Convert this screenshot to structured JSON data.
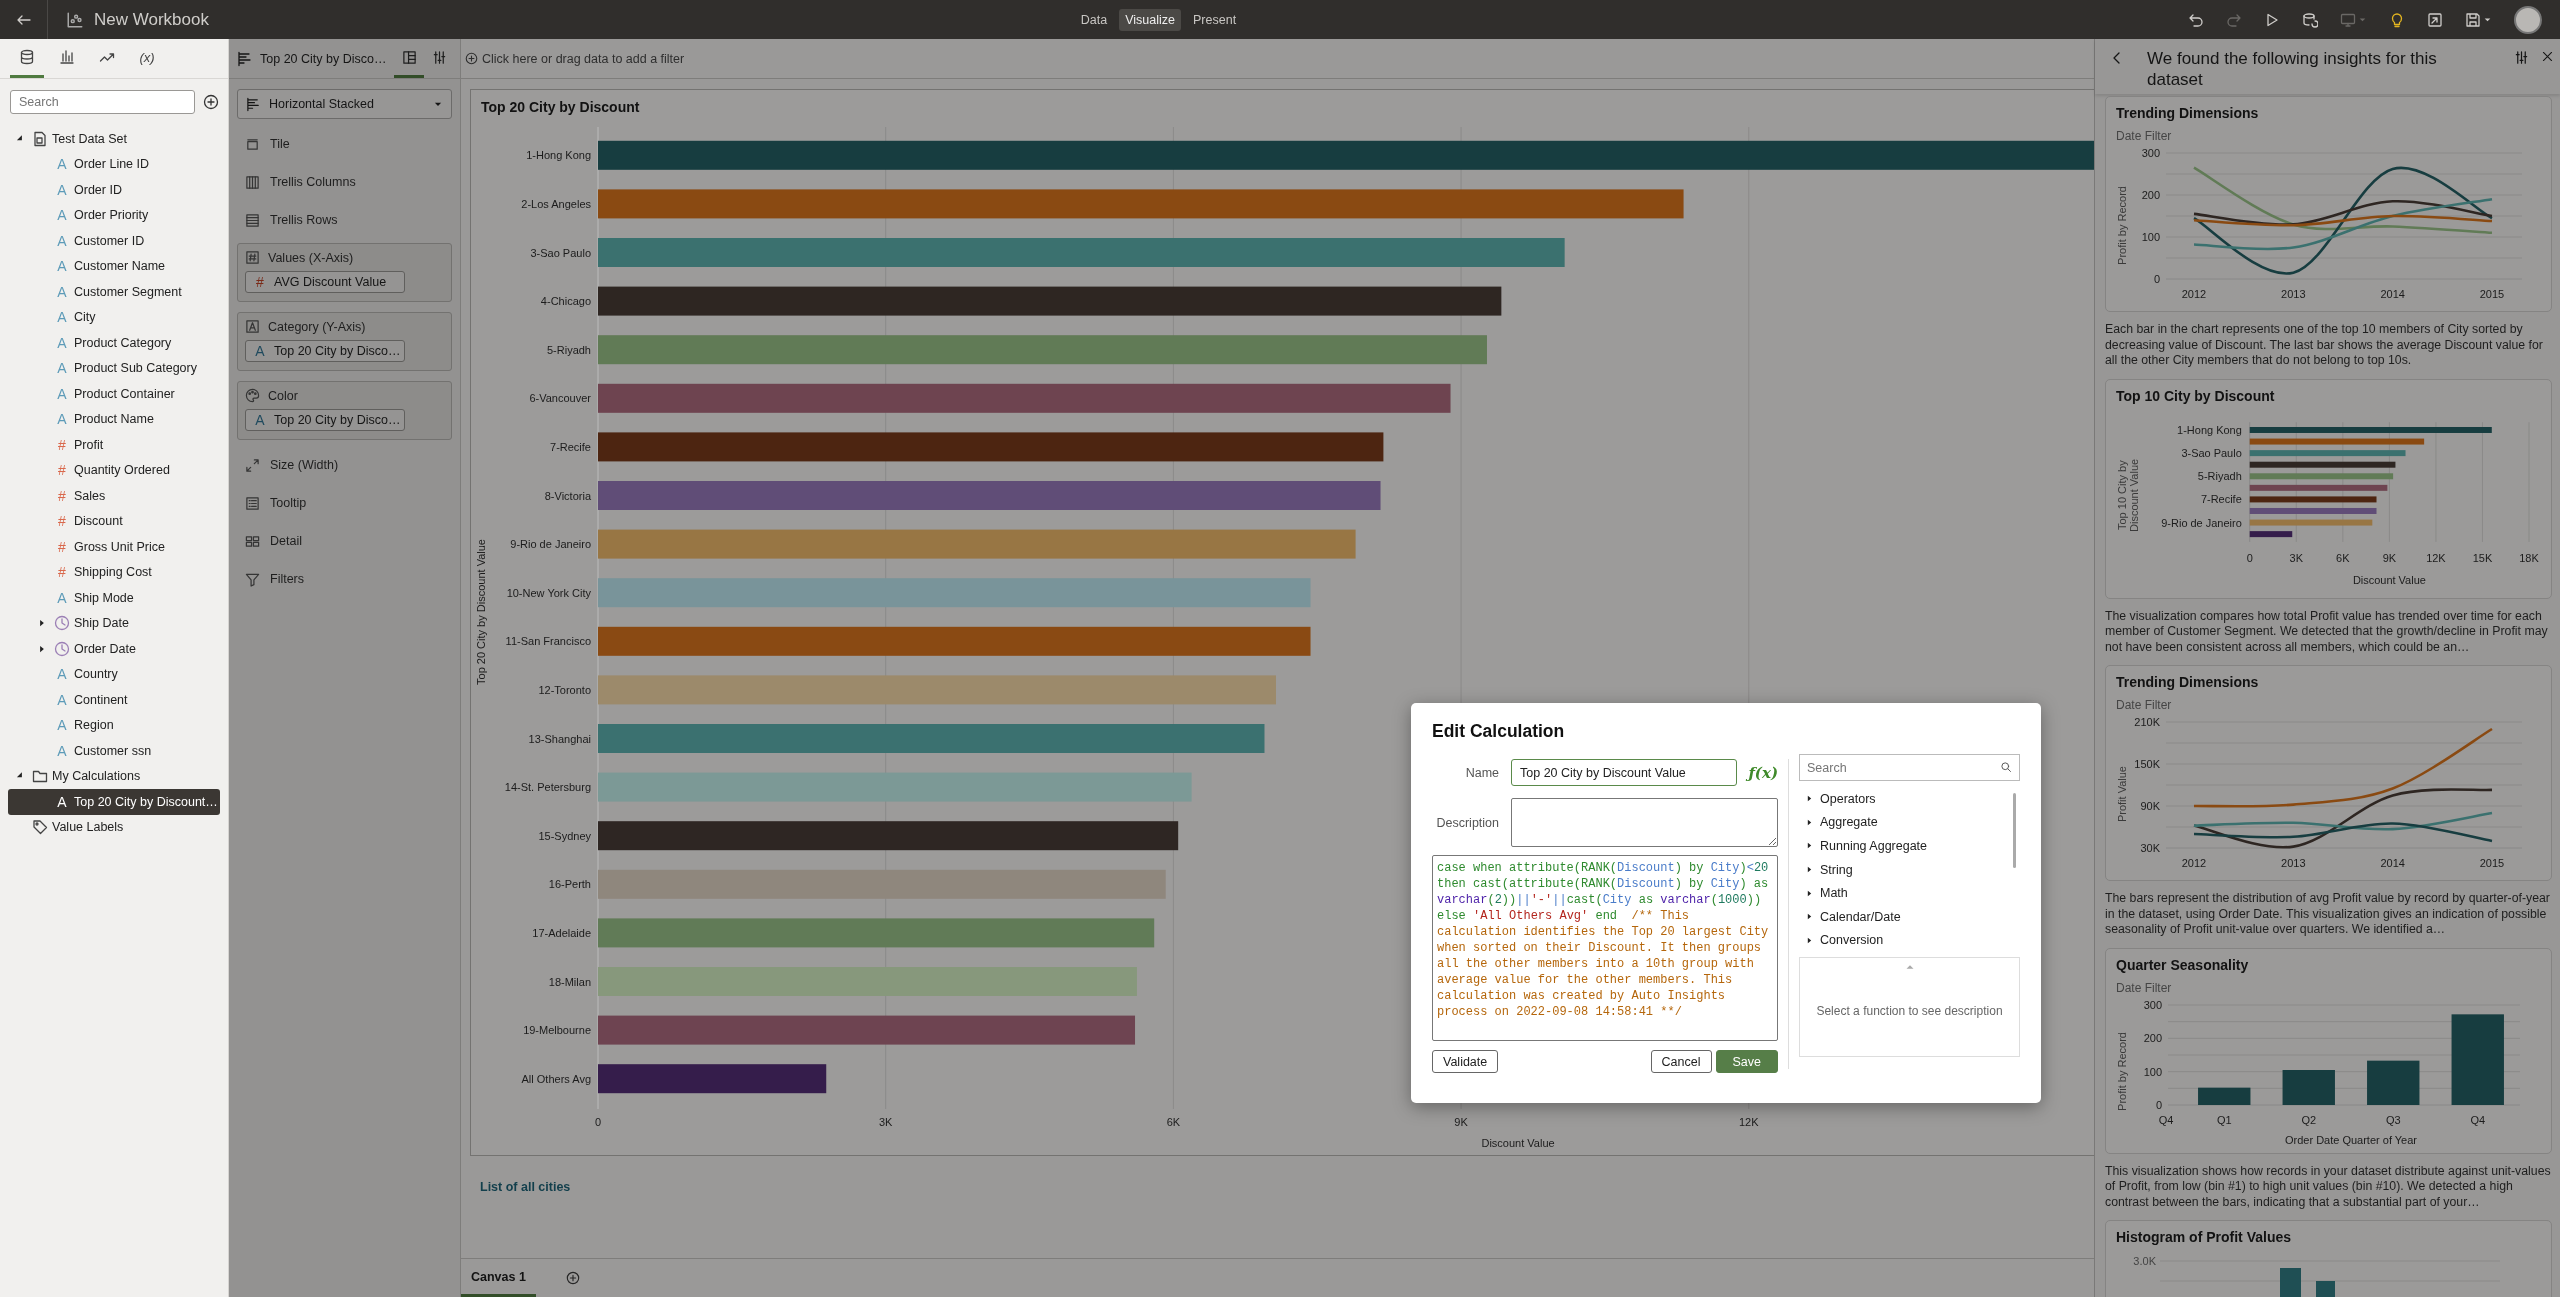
{
  "top_bar": {
    "title": "New Workbook",
    "modes": [
      {
        "label": "Data",
        "selected": false
      },
      {
        "label": "Visualize",
        "selected": true
      },
      {
        "label": "Present",
        "selected": false
      }
    ],
    "actions": [
      {
        "kind": "undo",
        "disabled": false
      },
      {
        "kind": "redo",
        "disabled": true
      },
      {
        "kind": "play",
        "disabled": false
      },
      {
        "kind": "refresh",
        "disabled": false
      },
      {
        "kind": "layout",
        "disabled": true
      },
      {
        "kind": "insights",
        "disabled": false
      },
      {
        "kind": "export",
        "disabled": false
      },
      {
        "kind": "save",
        "disabled": false
      }
    ]
  },
  "data_panel": {
    "tabs": [
      {
        "kind": "data",
        "selected": true
      },
      {
        "kind": "visualizations",
        "selected": false
      },
      {
        "kind": "analytics",
        "selected": false
      },
      {
        "kind": "calculations",
        "label": "(x)",
        "selected": false
      }
    ],
    "search": {
      "placeholder": "Search"
    },
    "tree": [
      {
        "label": "Test Data Set",
        "kind": "dataset",
        "expanded": true,
        "selected": false,
        "children": [
          {
            "label": "Order Line ID",
            "kind": "attribute",
            "icon": "A",
            "selected": false
          },
          {
            "label": "Order ID",
            "kind": "attribute",
            "icon": "A",
            "selected": false
          },
          {
            "label": "Order Priority",
            "kind": "attribute",
            "icon": "A",
            "selected": false
          },
          {
            "label": "Customer ID",
            "kind": "attribute",
            "icon": "A",
            "selected": false
          },
          {
            "label": "Customer Name",
            "kind": "attribute",
            "icon": "A",
            "selected": false
          },
          {
            "label": "Customer Segment",
            "kind": "attribute",
            "icon": "A",
            "selected": false
          },
          {
            "label": "City",
            "kind": "attribute",
            "icon": "A",
            "selected": false
          },
          {
            "label": "Product Category",
            "kind": "attribute",
            "icon": "A",
            "selected": false
          },
          {
            "label": "Product Sub Category",
            "kind": "attribute",
            "icon": "A",
            "selected": false
          },
          {
            "label": "Product Container",
            "kind": "attribute",
            "icon": "A",
            "selected": false
          },
          {
            "label": "Product Name",
            "kind": "attribute",
            "icon": "A",
            "selected": false
          },
          {
            "label": "Profit",
            "kind": "measure",
            "icon": "#",
            "selected": false
          },
          {
            "label": "Quantity Ordered",
            "kind": "measure",
            "icon": "#",
            "selected": false
          },
          {
            "label": "Sales",
            "kind": "measure",
            "icon": "#",
            "selected": false
          },
          {
            "label": "Discount",
            "kind": "measure",
            "icon": "#",
            "selected": false
          },
          {
            "label": "Gross Unit Price",
            "kind": "measure",
            "icon": "#",
            "selected": false
          },
          {
            "label": "Shipping Cost",
            "kind": "measure",
            "icon": "#",
            "selected": false
          },
          {
            "label": "Ship Mode",
            "kind": "attribute",
            "icon": "A",
            "selected": false
          },
          {
            "label": "Ship Date",
            "kind": "date",
            "expanded": false,
            "selected": false
          },
          {
            "label": "Order Date",
            "kind": "date",
            "expanded": false,
            "selected": false
          },
          {
            "label": "Country",
            "kind": "attribute",
            "icon": "A",
            "selected": false
          },
          {
            "label": "Continent",
            "kind": "attribute",
            "icon": "A",
            "selected": false
          },
          {
            "label": "Region",
            "kind": "attribute",
            "icon": "A",
            "selected": false
          },
          {
            "label": "Customer ssn",
            "kind": "attribute",
            "icon": "A",
            "selected": false
          }
        ]
      },
      {
        "label": "My Calculations",
        "kind": "folder",
        "expanded": true,
        "selected": false,
        "children": [
          {
            "label": "Top 20 City by Discount…",
            "kind": "attribute",
            "icon": "A",
            "selected": true
          }
        ]
      },
      {
        "label": "Value Labels",
        "kind": "labels",
        "selected": false
      }
    ]
  },
  "grammar_panel": {
    "tab": "Top 20 City by Disco…",
    "view_tabs": [
      {
        "kind": "layout",
        "selected": true
      },
      {
        "kind": "properties",
        "selected": false
      }
    ],
    "chart_type": "Horizontal Stacked",
    "items": [
      {
        "kind": "tile",
        "label": "Tile"
      },
      {
        "kind": "columns",
        "label": "Trellis Columns"
      },
      {
        "kind": "rows",
        "label": "Trellis Rows"
      },
      {
        "kind": "values_zone",
        "label": "Values (X-Axis)",
        "pill": {
          "kind": "measure",
          "icon": "#",
          "label": "AVG Discount Value"
        }
      },
      {
        "kind": "category_zone",
        "label": "Category (Y-Axis)",
        "pill": {
          "kind": "attribute",
          "icon": "A",
          "label": "Top 20 City by Disco…"
        }
      },
      {
        "kind": "color_zone",
        "label": "Color",
        "pill": {
          "kind": "attribute",
          "icon": "A",
          "label": "Top 20 City by Disco…"
        }
      },
      {
        "kind": "size",
        "label": "Size (Width)"
      },
      {
        "kind": "tooltip",
        "label": "Tooltip"
      },
      {
        "kind": "detail",
        "label": "Detail"
      },
      {
        "kind": "filters",
        "label": "Filters"
      }
    ]
  },
  "filter_bar": {
    "placeholder": "Click here or drag data to add a filter"
  },
  "main_chart": {
    "title": "Top 20 City by Discount",
    "bars": [
      {
        "color": "#173d40"
      },
      {
        "color": "#8a4a12"
      },
      {
        "color": "#3b716f"
      },
      {
        "color": "#2e2622"
      },
      {
        "color": "#617b56"
      },
      {
        "color": "#6e4450"
      },
      {
        "color": "#4d2511"
      },
      {
        "color": "#604d77"
      },
      {
        "color": "#987644"
      },
      {
        "color": "#79949a"
      },
      {
        "color": "#8a4a13"
      },
      {
        "color": "#9c8a6b"
      },
      {
        "color": "#3b7170"
      },
      {
        "color": "#7c9996"
      },
      {
        "color": "#2e2623"
      },
      {
        "color": "#8f877d"
      },
      {
        "color": "#617b57"
      },
      {
        "color": "#87987c"
      },
      {
        "color": "#6e4451"
      },
      {
        "color": "#351d4b"
      }
    ],
    "chart_data": {
      "type": "bar",
      "orientation": "horizontal",
      "xlabel": "Discount Value",
      "ylabel": "Top 20 City by Discount Value",
      "grid": true,
      "categories": [
        "1-Hong Kong",
        "2-Los Angeles",
        "3-Sao Paulo",
        "4-Chicago",
        "5-Riyadh",
        "6-Vancouver",
        "7-Recife",
        "8-Victoria",
        "9-Rio de Janeiro",
        "10-New York City",
        "11-San Francisco",
        "12-Toronto",
        "13-Shanghai",
        "14-St. Petersburg",
        "15-Sydney",
        "16-Perth",
        "17-Adelaide",
        "18-Milan",
        "19-Melbourne",
        "All Others Avg"
      ],
      "series": [
        {
          "values": [
            15600,
            11320,
            10080,
            9420,
            9270,
            8890,
            8190,
            8160,
            7900,
            7430,
            7430,
            7070,
            6950,
            6190,
            6050,
            5920,
            5800,
            5620,
            5600,
            2380
          ]
        }
      ],
      "xlim": [
        0,
        15600
      ],
      "xticks": [
        {
          "value": 0,
          "label": "0"
        },
        {
          "value": 3000,
          "label": "3K"
        },
        {
          "value": 6000,
          "label": "6K"
        },
        {
          "value": 9000,
          "label": "9K"
        },
        {
          "value": 12000,
          "label": "12K"
        }
      ]
    }
  },
  "link": "List of all cities",
  "canvas_tabs": [
    {
      "label": "Canvas 1",
      "selected": true
    }
  ],
  "insights": {
    "title": "We found the following insights for this dataset",
    "blocks": [
      {
        "kind": "chart_card",
        "title": "Trending Dimensions",
        "filter": "Date Filter",
        "chart_data": {
          "type": "line",
          "ylabel": "Profit by Record",
          "x": [
            "2012",
            "2013",
            "2014",
            "2015"
          ],
          "ylim": [
            0,
            300
          ],
          "yticks": [
            0,
            100,
            200,
            300
          ],
          "grid": true,
          "series": [
            {
              "color": "#617b56",
              "values": [
                265,
                130,
                125,
                110
              ]
            },
            {
              "color": "#173d40",
              "values": [
                145,
                15,
                262,
                145
              ]
            },
            {
              "color": "#2e2622",
              "values": [
                155,
                130,
                185,
                150
              ]
            },
            {
              "color": "#3b716f",
              "values": [
                82,
                75,
                150,
                190
              ]
            },
            {
              "color": "#8a4a12",
              "values": [
                140,
                128,
                150,
                138
              ]
            }
          ]
        }
      },
      {
        "kind": "text",
        "text": "Each bar in the chart represents one of the top 10 members of City sorted by decreasing value of Discount. The last bar shows the average Discount value for all the other City members that do not belong to top 10s."
      },
      {
        "kind": "chart_card",
        "title": "Top 10 City by Discount",
        "bars": [
          {
            "color": "#173d40"
          },
          {
            "color": "#8a4a12"
          },
          {
            "color": "#3b716f"
          },
          {
            "color": "#2e2622"
          },
          {
            "color": "#617b56"
          },
          {
            "color": "#6e4450"
          },
          {
            "color": "#4d2511"
          },
          {
            "color": "#604d77"
          },
          {
            "color": "#987644"
          },
          {
            "color": "#351d4b"
          }
        ],
        "chart_data": {
          "type": "bar",
          "orientation": "horizontal",
          "xlabel": "Discount Value",
          "ylabel": "Top 10 City by Discount Value",
          "grid": true,
          "categories": [
            "1-Hong Kong",
            null,
            "3-Sao Paulo",
            null,
            "5-Riyadh",
            null,
            "7-Recife",
            null,
            "9-Rio de Janeiro",
            null
          ],
          "series": [
            {
              "values": [
                15600,
                11240,
                10040,
                9390,
                9240,
                8870,
                8170,
                8170,
                7900,
                2740
              ]
            }
          ],
          "xlim": [
            0,
            18000
          ],
          "xticks": [
            {
              "value": 0,
              "label": "0"
            },
            {
              "value": 3000,
              "label": "3K"
            },
            {
              "value": 6000,
              "label": "6K"
            },
            {
              "value": 9000,
              "label": "9K"
            },
            {
              "value": 12000,
              "label": "12K"
            },
            {
              "value": 15000,
              "label": "15K"
            },
            {
              "value": 18000,
              "label": "18K"
            }
          ]
        }
      },
      {
        "kind": "text",
        "text": "The visualization compares how total Profit value has trended over time for each member of Customer Segment. We detected that the growth/decline in Profit may not have been consistent across all members, which could be an…"
      },
      {
        "kind": "chart_card",
        "title": "Trending Dimensions",
        "filter": "Date Filter",
        "chart_data": {
          "type": "line",
          "ylabel": "Profit Value",
          "x": [
            "2012",
            "2013",
            "2014",
            "2015"
          ],
          "ylim": [
            30000,
            210000
          ],
          "grid": true,
          "yticks": [
            {
              "value": 30000,
              "label": "30K"
            },
            {
              "value": 90000,
              "label": "90K"
            },
            {
              "value": 150000,
              "label": "150K"
            },
            {
              "value": 210000,
              "label": "210K"
            }
          ],
          "series": [
            {
              "color": "#2e2622",
              "values": [
                62000,
                32000,
                105000,
                113000
              ]
            },
            {
              "color": "#3b716f",
              "values": [
                62000,
                66000,
                57000,
                80000
              ]
            },
            {
              "color": "#173d40",
              "values": [
                50000,
                46000,
                65000,
                40000
              ]
            },
            {
              "color": "#8a4a12",
              "values": [
                90000,
                92000,
                115000,
                200000
              ]
            }
          ]
        }
      },
      {
        "kind": "text",
        "text": "The bars represent the distribution of avg Profit value by record by quarter-of-year in the dataset, using Order Date. This visualization gives an indication of possible seasonality of Profit unit-value over quarters. We identified a…"
      },
      {
        "kind": "chart_card",
        "title": "Quarter Seasonality",
        "filter": "Date Filter",
        "chart_data": {
          "type": "bar",
          "orientation": "vertical",
          "xlabel": "Order Date Quarter of Year",
          "ylabel": "Profit by Record",
          "categories": [
            "Q1",
            "Q2",
            "Q3",
            "Q4"
          ],
          "ylim": [
            0,
            300
          ],
          "yticks": [
            0,
            100,
            200,
            300
          ],
          "grid": true,
          "series": [
            {
              "color": "#173d40",
              "values": [
                52,
                105,
                133,
                272
              ]
            }
          ],
          "annotations": [
            {
              "text": "Q4"
            }
          ]
        }
      },
      {
        "kind": "text",
        "text": "This visualization shows how records in your dataset distribute against unit-values of Profit, from low (bin #1) to high unit values (bin #10). We detected a high contrast between the bars, indicating that a substantial part of your…"
      },
      {
        "kind": "histogram",
        "title": "Histogram of Profit Values",
        "ytick": "3.0K"
      }
    ]
  },
  "dialog": {
    "title": "Edit Calculation",
    "name_label": "Name",
    "name_value": "Top 20 City by Discount Value",
    "function_icon": "ƒ(x)",
    "description_label": "Description",
    "code": [
      {
        "kind": "keyword",
        "text": "case when attribute(RANK("
      },
      {
        "kind": "column",
        "text": "Discount"
      },
      {
        "kind": "keyword",
        "text": ") by "
      },
      {
        "kind": "column",
        "text": "City"
      },
      {
        "kind": "keyword",
        "text": ")"
      },
      {
        "kind": "operator",
        "text": "<"
      },
      {
        "kind": "number",
        "text": "20"
      },
      {
        "kind": "keyword",
        "text": " then cast(attribute(RANK("
      },
      {
        "kind": "column",
        "text": "Discount"
      },
      {
        "kind": "keyword",
        "text": ") by "
      },
      {
        "kind": "column",
        "text": "City"
      },
      {
        "kind": "keyword",
        "text": ") as "
      },
      {
        "kind": "type",
        "text": "varchar"
      },
      {
        "kind": "keyword",
        "text": "("
      },
      {
        "kind": "number",
        "text": "2"
      },
      {
        "kind": "keyword",
        "text": "))"
      },
      {
        "kind": "operator",
        "text": "||"
      },
      {
        "kind": "string",
        "text": "'-'"
      },
      {
        "kind": "operator",
        "text": "||"
      },
      {
        "kind": "keyword",
        "text": "cast("
      },
      {
        "kind": "column",
        "text": "City"
      },
      {
        "kind": "keyword",
        "text": " as "
      },
      {
        "kind": "type",
        "text": "varchar"
      },
      {
        "kind": "keyword",
        "text": "("
      },
      {
        "kind": "number",
        "text": "1000"
      },
      {
        "kind": "keyword",
        "text": ")) else "
      },
      {
        "kind": "string",
        "text": "'All Others Avg'"
      },
      {
        "kind": "keyword",
        "text": " end  "
      },
      {
        "kind": "comment",
        "text": "/** This calculation identifies the Top 20 largest City when sorted on their Discount. It then groups all the other members into a 10th group with average value for the other members. This calculation was created by Auto Insights process on 2022-09-08 14:58:41 **/"
      }
    ],
    "search": {
      "placeholder": "Search"
    },
    "categories": [
      {
        "label": "Operators",
        "expanded": false
      },
      {
        "label": "Aggregate",
        "expanded": false
      },
      {
        "label": "Running Aggregate",
        "expanded": false
      },
      {
        "label": "String",
        "expanded": false
      },
      {
        "label": "Math",
        "expanded": false
      },
      {
        "label": "Calendar/Date",
        "expanded": false
      },
      {
        "label": "Conversion",
        "expanded": false
      }
    ],
    "description_hint": "Select a function to see description",
    "buttons": [
      {
        "kind": "secondary",
        "label": "Validate"
      },
      {
        "kind": "secondary",
        "label": "Cancel"
      },
      {
        "kind": "primary",
        "label": "Save"
      }
    ]
  }
}
